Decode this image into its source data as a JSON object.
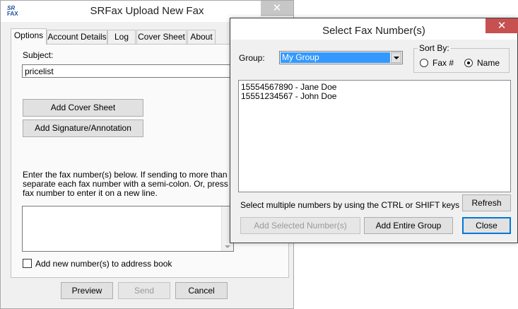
{
  "main_window": {
    "title": "SRFax Upload New Fax",
    "logo_top": "SR",
    "logo_bottom": "FAX",
    "close_glyph": "✕",
    "tabs": [
      {
        "label": "Options"
      },
      {
        "label": "Account Details"
      },
      {
        "label": "Log"
      },
      {
        "label": "Cover Sheet"
      },
      {
        "label": "About"
      }
    ],
    "subject_label": "Subject:",
    "subject_value": "pricelist",
    "add_cover_sheet_label": "Add Cover Sheet",
    "add_signature_label": "Add Signature/Annotation",
    "instructions": [
      "Enter the fax number(s) below.  If sending to more than one fax",
      "separate each fax number with a semi-colon.  Or, press 'Enter' a",
      "fax number to enter it on a new line."
    ],
    "fax_numbers_value": "",
    "add_to_address_book_label": "Add new number(s) to address book",
    "add_to_address_book_checked": false,
    "preview_label": "Preview",
    "send_label": "Send",
    "cancel_label": "Cancel"
  },
  "select_dialog": {
    "title": "Select Fax Number(s)",
    "close_glyph": "✕",
    "group_label": "Group:",
    "group_value": "My Group",
    "sort_by_label": "Sort By:",
    "sort_options": [
      {
        "label": "Fax #",
        "selected": false
      },
      {
        "label": "Name",
        "selected": true
      }
    ],
    "numbers": [
      "15554567890 - Jane Doe",
      "15551234567 - John Doe"
    ],
    "hint": "Select multiple numbers by using the CTRL or SHIFT keys",
    "refresh_label": "Refresh",
    "add_selected_label": "Add Selected Number(s)",
    "add_group_label": "Add Entire Group",
    "close_label": "Close"
  },
  "colors": {
    "close_red": "#c75050",
    "selection_blue": "#3399ff",
    "focus_blue": "#0078d7"
  }
}
